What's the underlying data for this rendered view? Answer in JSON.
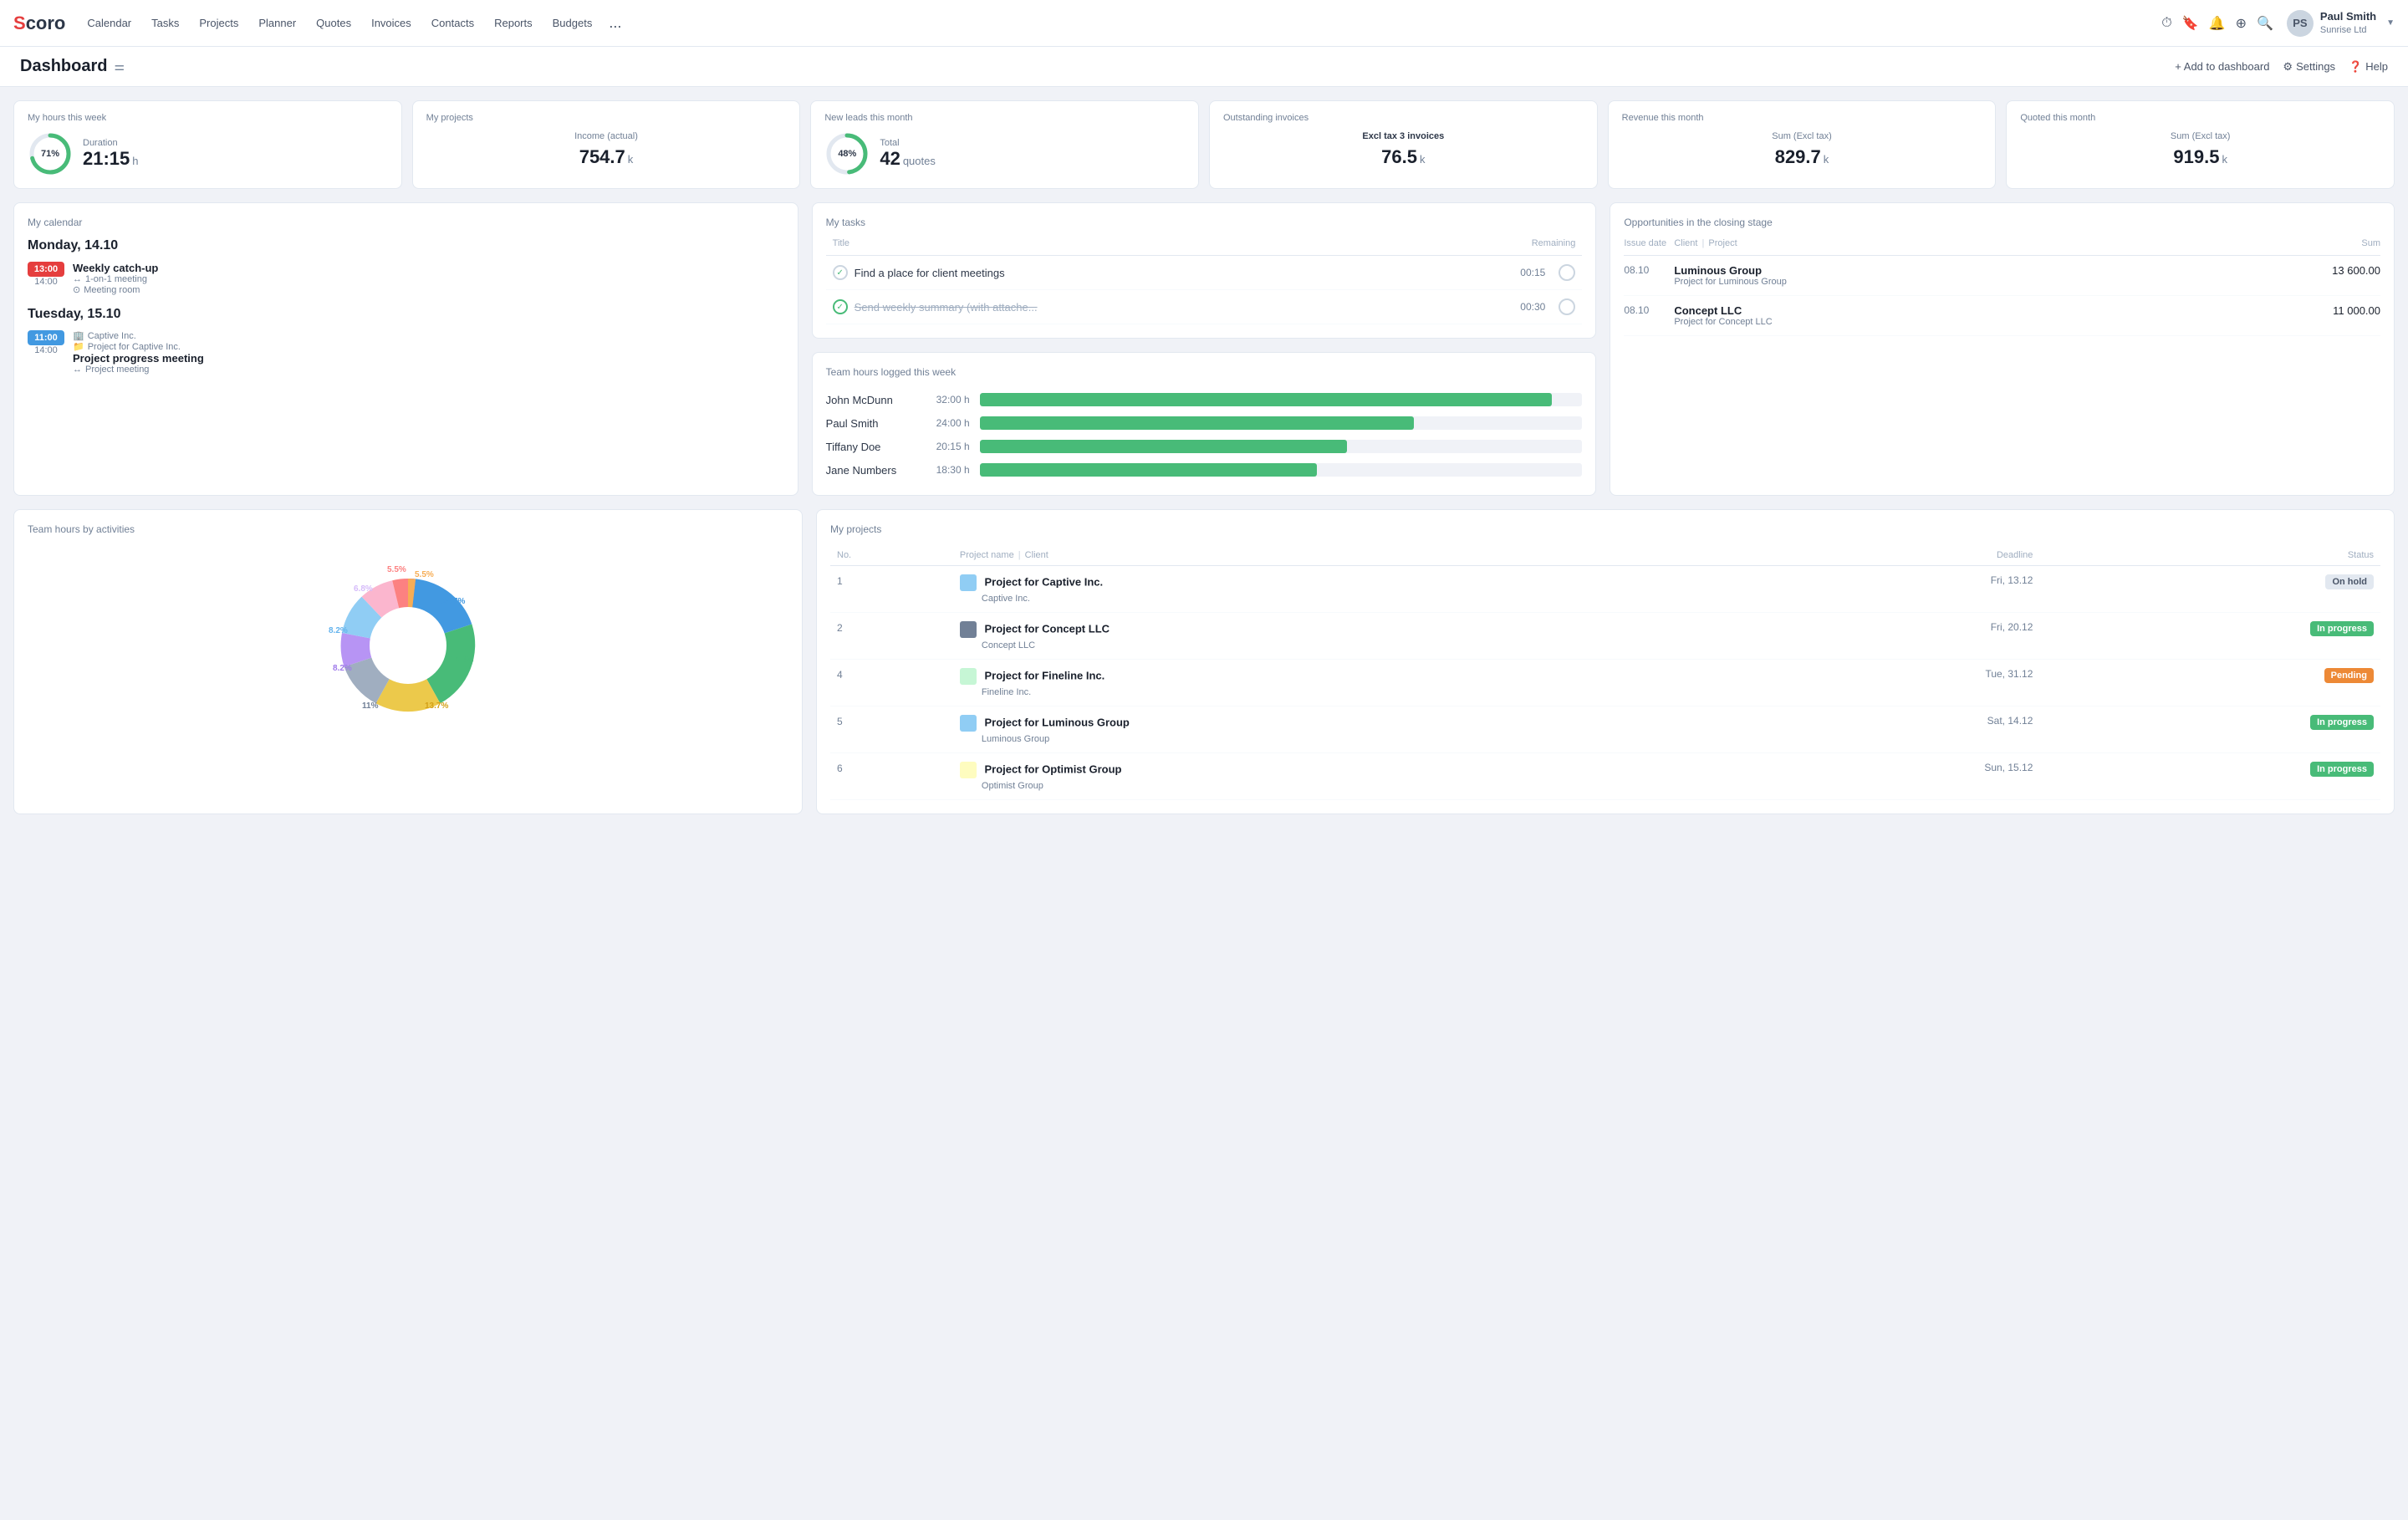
{
  "app": {
    "logo": "Scoro",
    "logo_s": "S",
    "logo_coro": "coro"
  },
  "nav": {
    "links": [
      "Calendar",
      "Tasks",
      "Projects",
      "Planner",
      "Quotes",
      "Invoices",
      "Contacts",
      "Reports",
      "Budgets"
    ],
    "more": "...",
    "user": {
      "name": "Paul Smith",
      "company": "Sunrise Ltd"
    }
  },
  "dashboard": {
    "title": "Dashboard",
    "actions": {
      "add": "+ Add to dashboard",
      "settings": "Settings",
      "help": "Help"
    }
  },
  "stat_cards": [
    {
      "title": "My hours this week",
      "pct": 71,
      "value": "21:15",
      "unit": "h",
      "label": "Duration"
    },
    {
      "title": "My projects",
      "sub_label": "Income (actual)",
      "value": "754.7",
      "unit": "k"
    },
    {
      "title": "New leads this month",
      "pct": 48,
      "value": "42",
      "unit": "quotes",
      "label": "Total"
    },
    {
      "title": "Outstanding invoices",
      "sub_label": "Excl tax 3 invoices",
      "value": "76.5",
      "unit": "k"
    },
    {
      "title": "Revenue this month",
      "sub_label": "Sum (Excl tax)",
      "value": "829.7",
      "unit": "k"
    },
    {
      "title": "Quoted this month",
      "sub_label": "Sum (Excl tax)",
      "value": "919.5",
      "unit": "k"
    }
  ],
  "calendar": {
    "title": "My calendar",
    "sections": [
      {
        "date": "Monday, 14.10",
        "events": [
          {
            "start": "13:00",
            "end": "14:00",
            "color": "red",
            "title": "Weekly catch-up",
            "details": [
              "1-on-1 meeting",
              "Meeting room"
            ]
          }
        ]
      },
      {
        "date": "Tuesday, 15.10",
        "events": [
          {
            "start": "11:00",
            "end": "14:00",
            "color": "blue",
            "company": "Captive Inc.",
            "project": "Project for Captive Inc.",
            "title": "Project progress meeting",
            "details": [
              "Project meeting"
            ]
          }
        ]
      }
    ]
  },
  "tasks": {
    "title": "My tasks",
    "headers": [
      "Title",
      "Remaining"
    ],
    "rows": [
      {
        "done": false,
        "title": "Find a place for client meetings",
        "remaining": "00:15"
      },
      {
        "done": true,
        "title": "Send weekly summary (with attache...",
        "remaining": "00:30"
      }
    ]
  },
  "opportunities": {
    "title": "Opportunities in the closing stage",
    "headers": [
      "Issue date",
      "Client | Project",
      "Sum"
    ],
    "rows": [
      {
        "date": "08.10",
        "client": "Luminous Group",
        "project": "Project for Luminous Group",
        "sum": "13 600.00"
      },
      {
        "date": "08.10",
        "client": "Concept LLC",
        "project": "Project for Concept LLC",
        "sum": "11 000.00"
      }
    ]
  },
  "team_hours": {
    "title": "Team hours logged this week",
    "rows": [
      {
        "name": "John McDunn",
        "hours": "32:00 h",
        "pct": 95
      },
      {
        "name": "Paul Smith",
        "hours": "24:00 h",
        "pct": 72
      },
      {
        "name": "Tiffany Doe",
        "hours": "20:15 h",
        "pct": 61
      },
      {
        "name": "Jane Numbers",
        "hours": "18:30 h",
        "pct": 56
      }
    ]
  },
  "team_activities": {
    "title": "Team hours by activities",
    "segments": [
      {
        "label": "24.7%",
        "pct": 24.7,
        "color": "#4299e1"
      },
      {
        "label": "16.4%",
        "pct": 16.4,
        "color": "#48bb78"
      },
      {
        "label": "13.7%",
        "pct": 13.7,
        "color": "#ecc94b"
      },
      {
        "label": "11%",
        "pct": 11,
        "color": "#a0aec0"
      },
      {
        "label": "8.2%",
        "pct": 8.2,
        "color": "#b794f4"
      },
      {
        "label": "8.2%",
        "pct": 8.2,
        "color": "#90cdf4"
      },
      {
        "label": "6.8%",
        "pct": 6.8,
        "color": "#fbb6ce"
      },
      {
        "label": "5.5%",
        "pct": 5.5,
        "color": "#fc8181"
      },
      {
        "label": "5.5%",
        "pct": 5.5,
        "color": "#f6ad55"
      }
    ]
  },
  "projects": {
    "title": "My projects",
    "headers": [
      "No.",
      "Project name | Client",
      "Deadline",
      "Status"
    ],
    "rows": [
      {
        "no": 1,
        "color": "#90cdf4",
        "name": "Project for Captive Inc.",
        "client": "Captive Inc.",
        "deadline": "Fri, 13.12",
        "status": "On hold",
        "status_type": "hold"
      },
      {
        "no": 2,
        "color": "#718096",
        "name": "Project for Concept LLC",
        "client": "Concept LLC",
        "deadline": "Fri, 20.12",
        "status": "In progress",
        "status_type": "progress"
      },
      {
        "no": 4,
        "color": "#c6f6d5",
        "name": "Project for Fineline Inc.",
        "client": "Fineline Inc.",
        "deadline": "Tue, 31.12",
        "status": "Pending",
        "status_type": "pending"
      },
      {
        "no": 5,
        "color": "#90cdf4",
        "name": "Project for Luminous Group",
        "client": "Luminous Group",
        "deadline": "Sat, 14.12",
        "status": "In progress",
        "status_type": "progress"
      },
      {
        "no": 6,
        "color": "#fefcbf",
        "name": "Project for Optimist Group",
        "client": "Optimist Group",
        "deadline": "Sun, 15.12",
        "status": "In progress",
        "status_type": "progress"
      }
    ]
  }
}
